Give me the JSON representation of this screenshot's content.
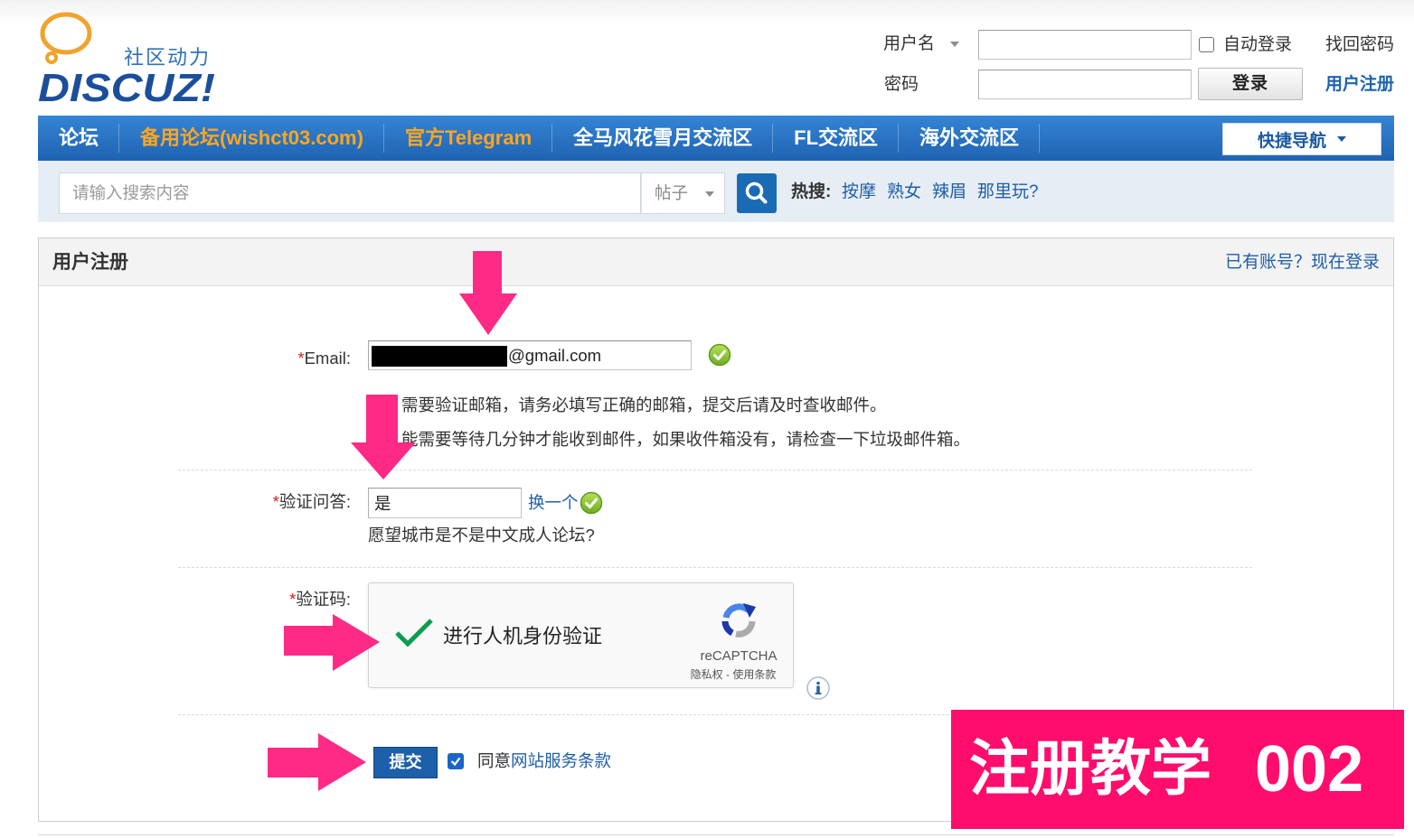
{
  "logo": {
    "tagline": "社区动力",
    "wordmark": "DISCUZ!"
  },
  "login": {
    "username_label": "用户名",
    "password_label": "密码",
    "auto_login_label": "自动登录",
    "auto_login_checked": false,
    "login_button": "登录",
    "forgot_password": "找回密码",
    "register_link": "用户注册"
  },
  "nav": {
    "items": [
      {
        "label": "论坛",
        "color": "#ffffff"
      },
      {
        "label": "备用论坛(wishct03.com)",
        "color": "#ffa51f"
      },
      {
        "label": "官方Telegram",
        "color": "#ffa51f"
      },
      {
        "label": "全马风花雪月交流区",
        "color": "#ffffff"
      },
      {
        "label": "FL交流区",
        "color": "#ffffff"
      },
      {
        "label": "海外交流区",
        "color": "#ffffff"
      }
    ],
    "quick_nav_label": "快捷导航"
  },
  "search": {
    "placeholder": "请输入搜索内容",
    "scope": "帖子",
    "hot_label": "热搜:",
    "hot_terms": [
      "按摩",
      "熟女",
      "辣眉",
      "那里玩?"
    ]
  },
  "register": {
    "title": "用户注册",
    "login_link": "已有账号？现在登录",
    "required_mark": "*",
    "email": {
      "label": "Email:",
      "value": "@gmail.com",
      "prefix_redacted": true,
      "valid": true,
      "hints": [
        "需要验证邮箱，请务必填写正确的邮箱，提交后请及时查收邮件。",
        "能需要等待几分钟才能收到邮件，如果收件箱没有，请检查一下垃圾邮件箱。"
      ]
    },
    "question": {
      "label": "验证问答:",
      "value": "是",
      "refresh_link": "换一个",
      "valid": true,
      "prompt": "愿望城市是不是中文成人论坛?"
    },
    "captcha": {
      "label": "验证码:",
      "checkbox_label": "进行人机身份验证",
      "checked": true,
      "brand": "reCAPTCHA",
      "legal": "隐私权 - 使用条款"
    },
    "submit_label": "提交",
    "agree_checked": true,
    "agree_prefix": "同意",
    "agree_link": "网站服务条款"
  },
  "overlay": {
    "banner_title": "注册教学",
    "banner_number": "002"
  },
  "colors": {
    "link": "#1f5ea8",
    "register_link": "#1d63ad",
    "required": "#e02020",
    "captcha_check": "#0b9d4f",
    "primary_button": "#1d5fa9",
    "annotation_arrow": "#ff2a85",
    "banner_bg": "#fe0d6d"
  }
}
